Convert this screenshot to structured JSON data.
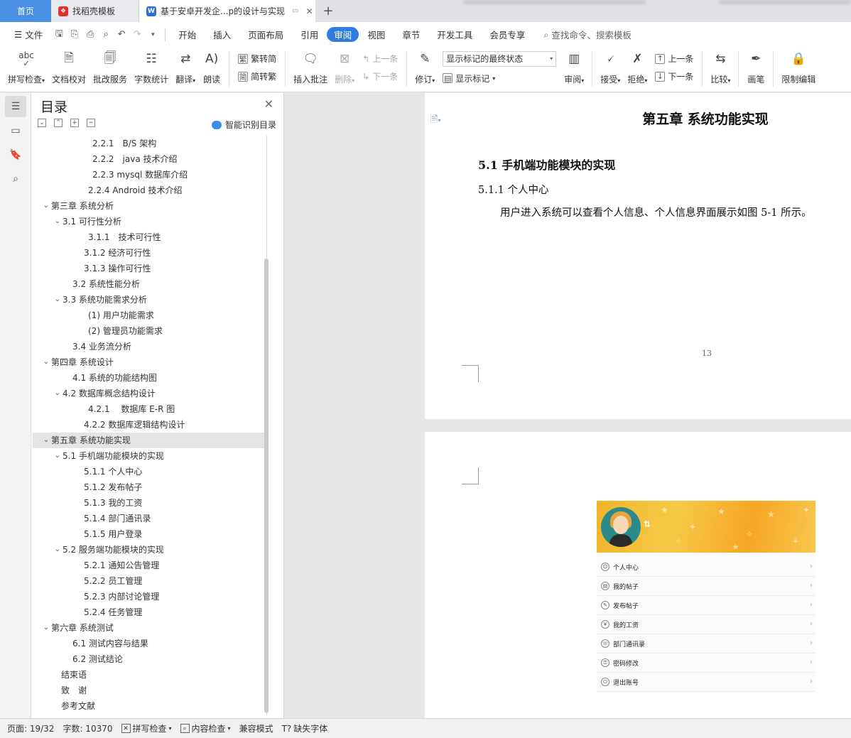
{
  "tabs": {
    "home": "首页",
    "template": "找稻壳模板",
    "document": "基于安卓开发企...p的设计与实现",
    "add": "+"
  },
  "menu": {
    "file": "文件",
    "items": [
      "开始",
      "插入",
      "页面布局",
      "引用",
      "审阅",
      "视图",
      "章节",
      "开发工具",
      "会员专享"
    ],
    "active": "审阅",
    "search_placeholder": "查找命令、搜索模板"
  },
  "ribbon": {
    "spellcheck": "拼写检查",
    "doc_proof": "文档校对",
    "review_service": "批改服务",
    "word_count": "字数统计",
    "translate": "翻译",
    "read_aloud": "朗读",
    "trad_to_simp": "繁转简",
    "simp_to_trad": "简转繁",
    "insert_comment": "插入批注",
    "delete": "删除",
    "prev_comment": "上一条",
    "next_comment": "下一条",
    "track_changes": "修订",
    "markup_state": "显示标记的最终状态",
    "show_markup": "显示标记",
    "review": "审阅",
    "accept": "接受",
    "reject": "拒绝",
    "prev_change": "上一条",
    "next_change": "下一条",
    "compare": "比较",
    "pen": "画笔",
    "restrict_edit": "限制编辑",
    "spell_icon_text": "abc"
  },
  "toc": {
    "title": "目录",
    "smart_toc": "智能识别目录",
    "items": [
      {
        "label": "2.2.1　B/S 架构",
        "indent": 72,
        "arrow": ""
      },
      {
        "label": "2.2.2　java 技术介绍",
        "indent": 72,
        "arrow": ""
      },
      {
        "label": "2.2.3 mysql 数据库介绍",
        "indent": 72,
        "arrow": ""
      },
      {
        "label": "2.2.4 Android 技术介绍",
        "indent": 66,
        "arrow": ""
      },
      {
        "label": "第三章  系统分析",
        "indent": 14,
        "arrow": "v"
      },
      {
        "label": "3.1  可行性分析",
        "indent": 30,
        "arrow": "v"
      },
      {
        "label": "3.1.1　技术可行性",
        "indent": 66,
        "arrow": ""
      },
      {
        "label": "3.1.2  经济可行性",
        "indent": 60,
        "arrow": ""
      },
      {
        "label": "3.1.3  操作可行性",
        "indent": 60,
        "arrow": ""
      },
      {
        "label": "3.2  系统性能分析",
        "indent": 44,
        "arrow": ""
      },
      {
        "label": "3.3  系统功能需求分析",
        "indent": 30,
        "arrow": "v"
      },
      {
        "label": "(1)  用户功能需求",
        "indent": 66,
        "arrow": ""
      },
      {
        "label": "(2)  管理员功能需求",
        "indent": 66,
        "arrow": ""
      },
      {
        "label": "3.4  业务流分析",
        "indent": 44,
        "arrow": ""
      },
      {
        "label": "第四章  系统设计",
        "indent": 14,
        "arrow": "v"
      },
      {
        "label": "4.1  系统的功能结构图",
        "indent": 44,
        "arrow": ""
      },
      {
        "label": "4.2  数据库概念结构设计",
        "indent": 30,
        "arrow": "v"
      },
      {
        "label": "4.2.1　 数据库 E-R 图",
        "indent": 66,
        "arrow": ""
      },
      {
        "label": "4.2.2  数据库逻辑结构设计",
        "indent": 60,
        "arrow": ""
      },
      {
        "label": "第五章  系统功能实现",
        "indent": 14,
        "arrow": "v",
        "selected": true
      },
      {
        "label": "5.1  手机端功能模块的实现",
        "indent": 30,
        "arrow": "v"
      },
      {
        "label": "5.1.1 个人中心",
        "indent": 60,
        "arrow": ""
      },
      {
        "label": "5.1.2 发布帖子",
        "indent": 60,
        "arrow": ""
      },
      {
        "label": "5.1.3 我的工资",
        "indent": 60,
        "arrow": ""
      },
      {
        "label": "5.1.4 部门通讯录",
        "indent": 60,
        "arrow": ""
      },
      {
        "label": "5.1.5 用户登录",
        "indent": 60,
        "arrow": ""
      },
      {
        "label": "5.2 服务端功能模块的实现",
        "indent": 30,
        "arrow": "v"
      },
      {
        "label": "5.2.1 通知公告管理",
        "indent": 60,
        "arrow": ""
      },
      {
        "label": "5.2.2 员工管理",
        "indent": 60,
        "arrow": ""
      },
      {
        "label": "5.2.3 内部讨论管理",
        "indent": 60,
        "arrow": ""
      },
      {
        "label": "5.2.4 任务管理",
        "indent": 60,
        "arrow": ""
      },
      {
        "label": "第六章  系统测试",
        "indent": 14,
        "arrow": "v"
      },
      {
        "label": "6.1  测试内容与结果",
        "indent": 44,
        "arrow": ""
      },
      {
        "label": "6.2  测试结论",
        "indent": 44,
        "arrow": ""
      },
      {
        "label": "结束语",
        "indent": 28,
        "arrow": ""
      },
      {
        "label": "致　谢",
        "indent": 28,
        "arrow": ""
      },
      {
        "label": "参考文献",
        "indent": 28,
        "arrow": ""
      }
    ]
  },
  "document": {
    "chapter_title": "第五章  系统功能实现",
    "section_title": "5.1  手机端功能模块的实现",
    "subsection_title": "5.1.1 个人中心",
    "paragraph": "用户进入系统可以查看个人信息、个人信息界面展示如图 5-1 所示。",
    "page_number": "13"
  },
  "phone_screen": {
    "menu": [
      "个人中心",
      "我的帖子",
      "发布帖子",
      "我的工资",
      "部门通讯录",
      "密码修改",
      "退出账号"
    ]
  },
  "status": {
    "page": "页面: 19/32",
    "words": "字数: 10370",
    "spellcheck": "拼写检查",
    "content_check": "内容检查",
    "compat_mode": "兼容模式",
    "missing_font": "缺失字体"
  },
  "colors": {
    "accent": "#2f7de1",
    "home_tab": "#4a90e2",
    "phone_header": "#f5b731"
  }
}
